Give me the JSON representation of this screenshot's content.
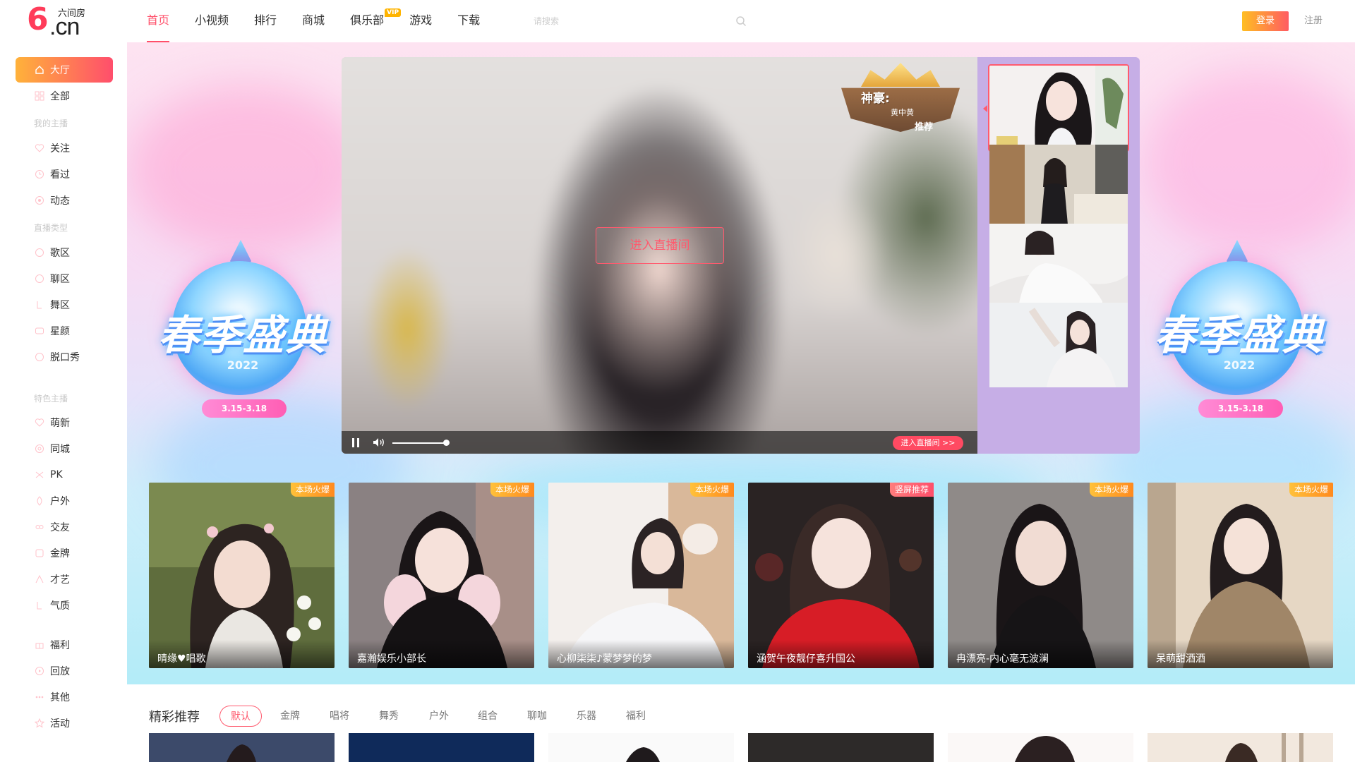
{
  "logo": {
    "mark": "6",
    "domain": ".cn",
    "sub": "六间房"
  },
  "nav": [
    {
      "label": "首页",
      "active": true
    },
    {
      "label": "小视频"
    },
    {
      "label": "排行"
    },
    {
      "label": "商城"
    },
    {
      "label": "俱乐部",
      "badge": "VIP"
    },
    {
      "label": "游戏"
    },
    {
      "label": "下载"
    }
  ],
  "search": {
    "placeholder": "请搜索"
  },
  "header": {
    "login": "登录",
    "register": "注册"
  },
  "sidebar": {
    "hall": "大厅",
    "all": "全部",
    "my_anchors_head": "我的主播",
    "follow": "关注",
    "watched": "看过",
    "moments": "动态",
    "live_type_head": "直播类型",
    "singing": "歌区",
    "chat": "聊区",
    "dance": "舞区",
    "star": "星颜",
    "talkshow": "脱口秀",
    "special_head": "特色主播",
    "cute": "萌新",
    "local": "同城",
    "pk": "PK",
    "outdoor": "户外",
    "dating": "交友",
    "gold": "金牌",
    "talent": "才艺",
    "temperament": "气质",
    "welfare": "福利",
    "replay": "回放",
    "other": "其他",
    "events": "活动"
  },
  "banner": {
    "title": "春季盛典",
    "year": "2022",
    "pill": "3.15-3.18"
  },
  "player": {
    "enter_button": "进入直播间",
    "enter_small": "进入直播间 >>",
    "crown_title": "神豪:",
    "crown_name": "黄中黄",
    "crown_rec": "推荐"
  },
  "featured": [
    {
      "caption": "晴缘♥唱歌",
      "badge": "本场火爆"
    },
    {
      "caption": "嘉瀚娱乐小部长",
      "badge": "本场火爆"
    },
    {
      "caption": "心柳柒柒♪蒙梦梦的梦",
      "badge": "本场火爆"
    },
    {
      "caption": "涵贺午夜靓仔喜升国公",
      "badge": "竖屏推荐"
    },
    {
      "caption": "冉漂亮-内心毫无波澜",
      "badge": "本场火爆"
    },
    {
      "caption": "呆萌甜酒酒",
      "badge": "本场火爆"
    }
  ],
  "recommend": {
    "title": "精彩推荐",
    "tabs": [
      "默认",
      "金牌",
      "唱将",
      "舞秀",
      "户外",
      "组合",
      "聊咖",
      "乐器",
      "福利"
    ]
  },
  "colors": {
    "accent": "#ff4f6a",
    "gold": "#ffb400"
  }
}
